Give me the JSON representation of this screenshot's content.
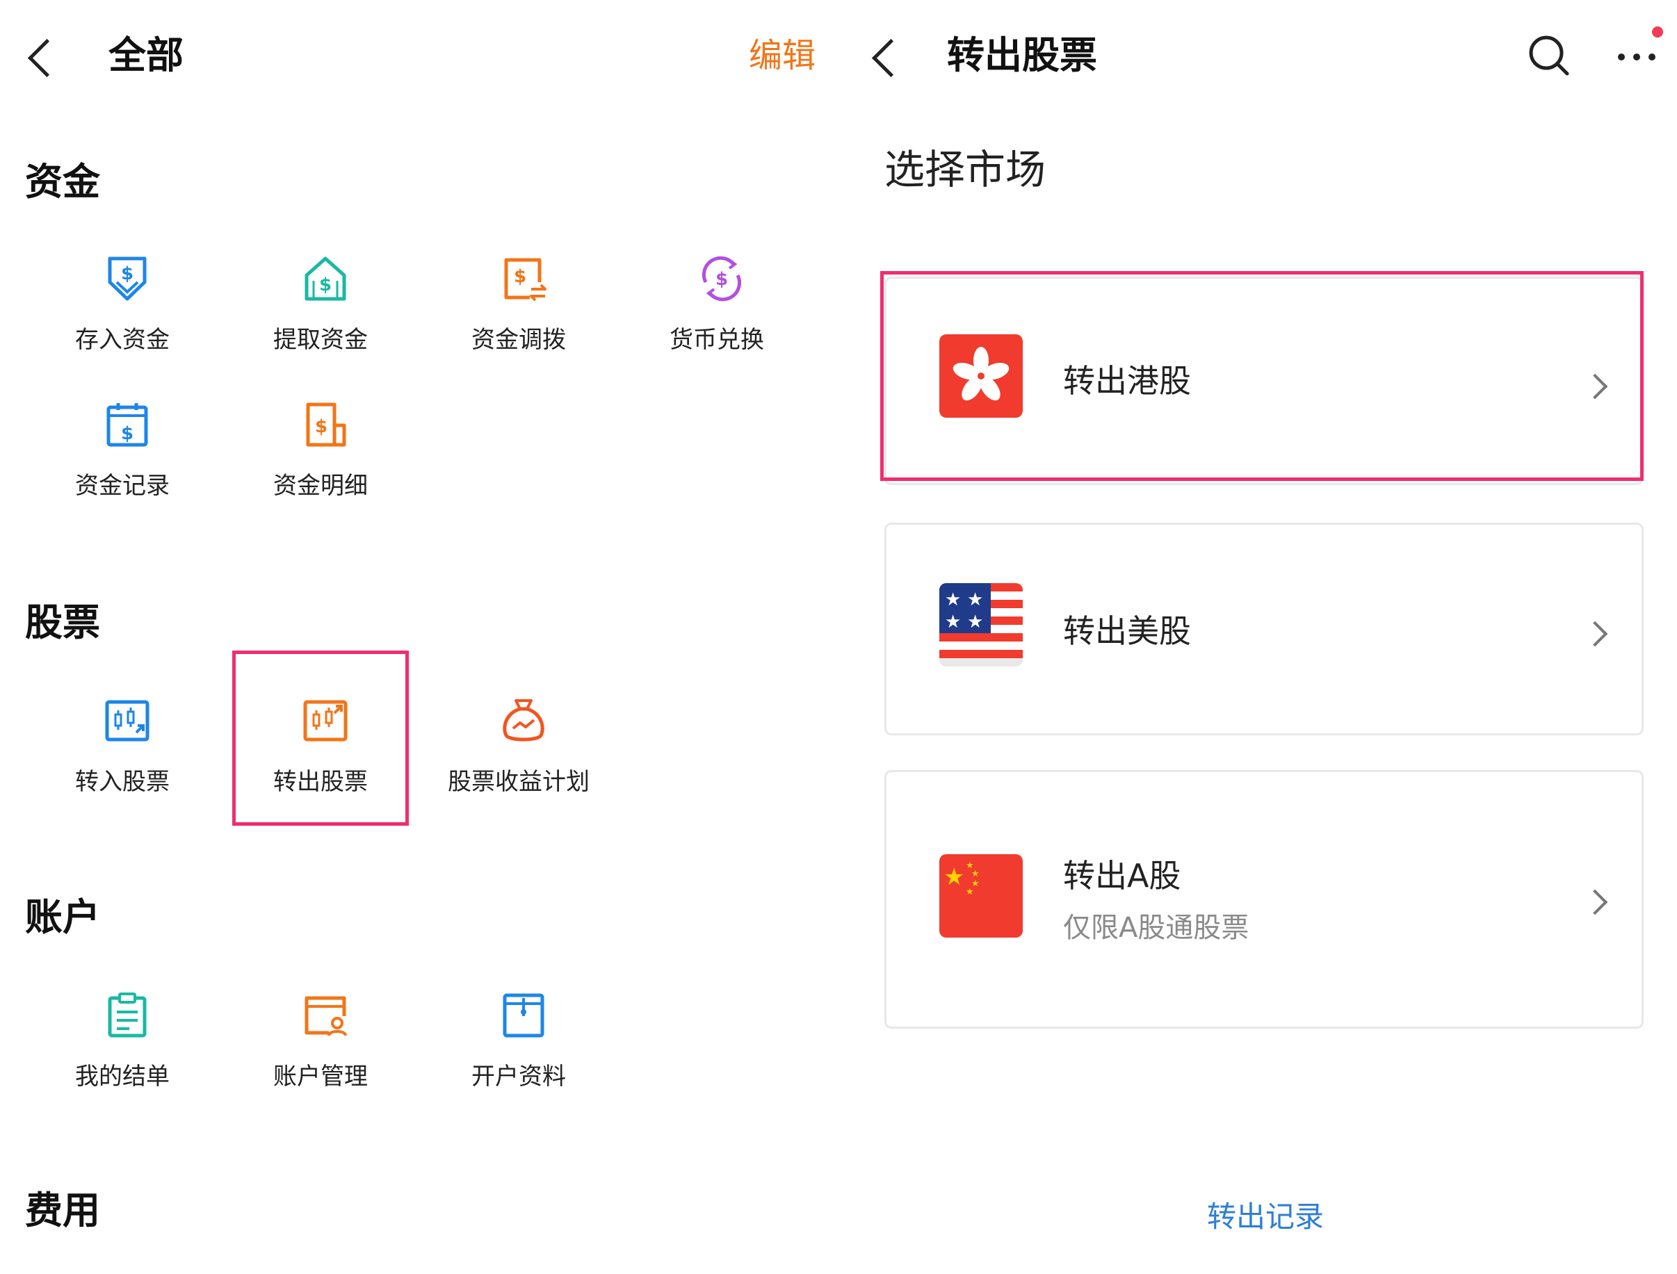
{
  "left_panel": {
    "title": "全部",
    "edit_label": "编辑",
    "sections": {
      "funds": {
        "title": "资金",
        "items": [
          {
            "label": "存入资金",
            "icon": "deposit-icon",
            "color": "#1e86e8"
          },
          {
            "label": "提取资金",
            "icon": "withdraw-icon",
            "color": "#19b9a3"
          },
          {
            "label": "资金调拨",
            "icon": "transfer-funds-icon",
            "color": "#f27518"
          },
          {
            "label": "货币兑换",
            "icon": "currency-exchange-icon",
            "color": "#b44fe0"
          },
          {
            "label": "资金记录",
            "icon": "fund-record-icon",
            "color": "#1e86e8"
          },
          {
            "label": "资金明细",
            "icon": "fund-detail-icon",
            "color": "#f27518"
          }
        ]
      },
      "stocks": {
        "title": "股票",
        "items": [
          {
            "label": "转入股票",
            "icon": "stock-in-icon",
            "color": "#1e86e8"
          },
          {
            "label": "转出股票",
            "icon": "stock-out-icon",
            "color": "#f27518"
          },
          {
            "label": "股票收益计划",
            "icon": "money-bag-icon",
            "color": "#f2551e"
          }
        ]
      },
      "account": {
        "title": "账户",
        "items": [
          {
            "label": "我的结单",
            "icon": "statement-icon",
            "color": "#19b9a3"
          },
          {
            "label": "账户管理",
            "icon": "account-manage-icon",
            "color": "#f27518"
          },
          {
            "label": "开户资料",
            "icon": "account-info-icon",
            "color": "#1e86e8"
          }
        ]
      },
      "fees": {
        "title": "费用"
      }
    }
  },
  "right_panel": {
    "title": "转出股票",
    "subtitle": "选择市场",
    "markets": [
      {
        "label": "转出港股",
        "flag": "hk-flag-icon"
      },
      {
        "label": "转出美股",
        "flag": "us-flag-icon"
      },
      {
        "label": "转出A股",
        "sublabel": "仅限A股通股票",
        "flag": "cn-flag-icon"
      }
    ],
    "record_link": "转出记录"
  },
  "colors": {
    "accent_orange": "#f27518",
    "highlight": "#ef2e6e",
    "link_blue": "#2d7fd6",
    "notification_dot": "#f23a5a"
  }
}
